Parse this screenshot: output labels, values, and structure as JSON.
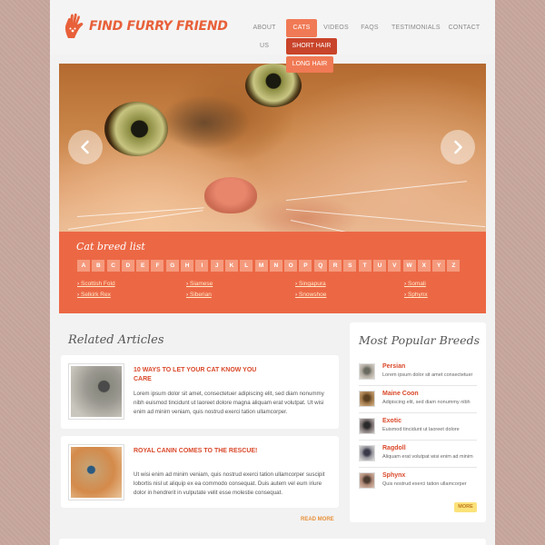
{
  "header": {
    "logo_text": "FIND FURRY FRIEND",
    "nav": [
      {
        "label": "ABOUT US"
      },
      {
        "label": "CATS"
      },
      {
        "label": "VIDEOS"
      },
      {
        "label": "FAQS"
      },
      {
        "label": "TESTIMONIALS"
      },
      {
        "label": "CONTACT"
      }
    ],
    "dropdown": [
      "SHORT HAIR",
      "LONG HAIR"
    ]
  },
  "slider": {
    "prev_icon": "chevron-left-icon",
    "next_icon": "chevron-right-icon"
  },
  "breed_list": {
    "title": "Cat breed list",
    "letters": [
      "A",
      "B",
      "C",
      "D",
      "E",
      "F",
      "G",
      "H",
      "I",
      "J",
      "K",
      "L",
      "M",
      "N",
      "O",
      "P",
      "Q",
      "R",
      "S",
      "T",
      "U",
      "V",
      "W",
      "X",
      "Y",
      "Z"
    ],
    "columns": [
      [
        "Scottish Fold",
        "Selkirk Rex"
      ],
      [
        "Siamese",
        "Siberian"
      ],
      [
        "Singapura",
        "Snowshoe"
      ],
      [
        "Somali",
        "Sphynx"
      ]
    ]
  },
  "related": {
    "title": "Related Articles",
    "articles": [
      {
        "title": "10 WAYS TO LET YOUR CAT KNOW YOU CARE",
        "body": "Lorem ipsum dolor sit amet, consectetuer adipiscing elit, sed diam nonummy nibh euismod tincidunt ut laoreet dolore magna aliquam erat volutpat. Ut wisi enim ad minim veniam, quis nostrud exerci tation ullamcorper."
      },
      {
        "title": "ROYAL CANIN COMES TO THE RESCUE!",
        "body": "Ut wisi enim ad minim veniam, quis nostrud exerci tation ullamcorper suscipit lobortis nisl ut aliquip ex ea commodo consequat. Duis autem vel eum iriure dolor in hendrerit in vulputate velit esse molestie consequat."
      }
    ],
    "read_more": "READ MORE"
  },
  "popular": {
    "title": "Most Popular Breeds",
    "items": [
      {
        "name": "Persian",
        "desc": "Lorem ipsum dolor sit amet consectetuer"
      },
      {
        "name": "Maine Coon",
        "desc": "Adipiscing elit, sed diam nonummy nibh"
      },
      {
        "name": "Exotic",
        "desc": "Euismod tincidunt ut laoreet dolore"
      },
      {
        "name": "Ragdoll",
        "desc": "Aliquam erat volutpat wisi enim ad minim"
      },
      {
        "name": "Sphynx",
        "desc": "Quis nostrud exerci tation ullamcorper"
      }
    ],
    "more_label": "MORE"
  },
  "colors": {
    "accent": "#ec6845",
    "accent_dark": "#c8442a",
    "title_red": "#d9482a",
    "more_yellow": "#fbe27a"
  }
}
